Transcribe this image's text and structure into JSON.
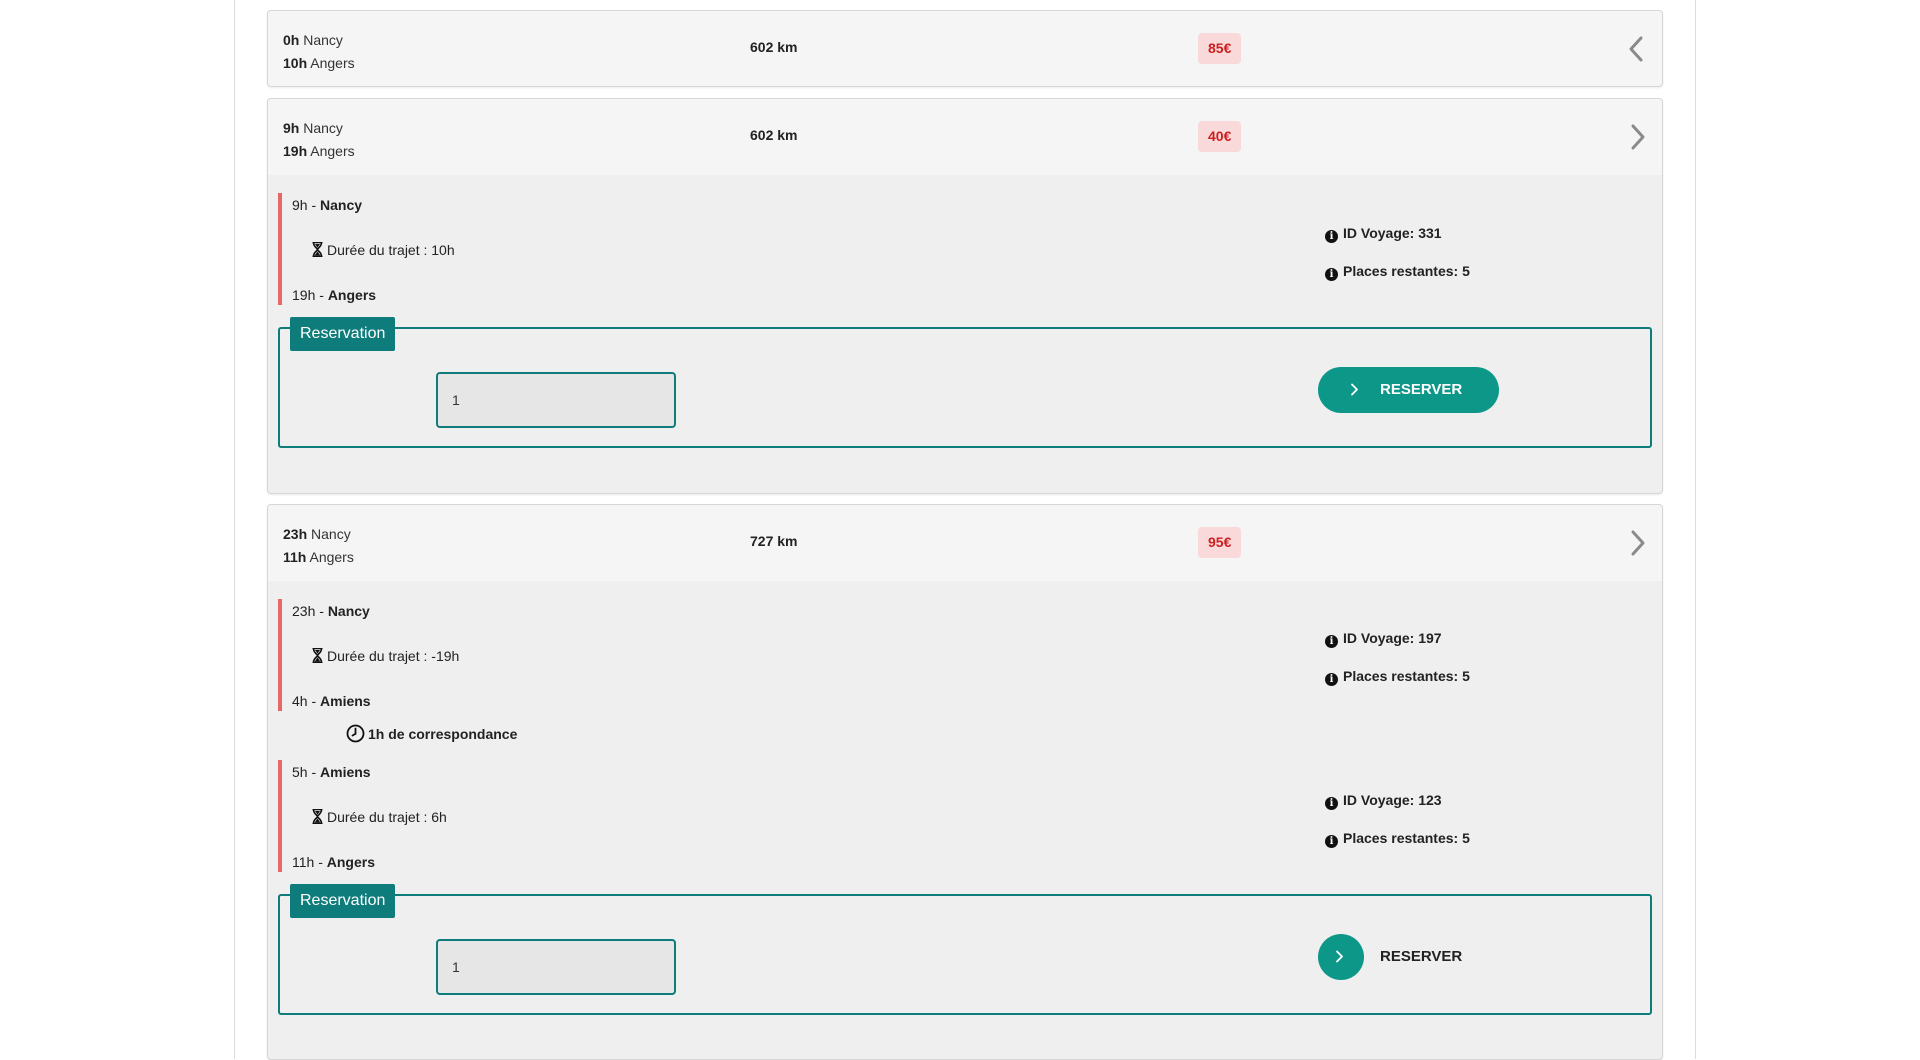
{
  "trips": [
    {
      "departure_time": "0h",
      "departure_city": "Nancy",
      "arrival_time": "10h",
      "arrival_city": "Angers",
      "distance": "602 km",
      "price": "85€",
      "expanded": false
    },
    {
      "departure_time": "9h",
      "departure_city": "Nancy",
      "arrival_time": "19h",
      "arrival_city": "Angers",
      "distance": "602 km",
      "price": "40€",
      "expanded": true,
      "segments": [
        {
          "from_time": "9h -",
          "from_city": "Nancy",
          "duration_label": "Durée du trajet : 10h",
          "to_time": "19h -",
          "to_city": "Angers",
          "id_voyage": "ID Voyage: 331",
          "places": "Places restantes: 5"
        }
      ],
      "reservation": {
        "legend": "Reservation",
        "seats_value": "1",
        "button_label": "RESERVER"
      }
    },
    {
      "departure_time": "23h",
      "departure_city": "Nancy",
      "arrival_time": "11h",
      "arrival_city": "Angers",
      "distance": "727 km",
      "price": "95€",
      "expanded": true,
      "segments": [
        {
          "from_time": "23h -",
          "from_city": "Nancy",
          "duration_label": "Durée du trajet : -19h",
          "to_time": "4h -",
          "to_city": "Amiens",
          "id_voyage": "ID Voyage: 197",
          "places": "Places restantes: 5"
        },
        {
          "from_time": "5h -",
          "from_city": "Amiens",
          "duration_label": "Durée du trajet : 6h",
          "to_time": "11h -",
          "to_city": "Angers",
          "id_voyage": "ID Voyage: 123",
          "places": "Places restantes: 5"
        }
      ],
      "connection": "1h de correspondance",
      "reservation": {
        "legend": "Reservation",
        "seats_value": "1",
        "button_label": "RESERVER"
      }
    }
  ],
  "colors": {
    "accent_teal": "#0e7c7b",
    "button_teal": "#0d9788",
    "segment_line": "#e56767",
    "price_bg": "#f9d9d9",
    "price_text": "#cc1f1f"
  },
  "icons": {
    "collapse": "chevron-left-icon",
    "expand": "chevron-right-icon",
    "duration": "hourglass-icon",
    "info": "info-circle-icon",
    "connection": "clock-icon"
  }
}
